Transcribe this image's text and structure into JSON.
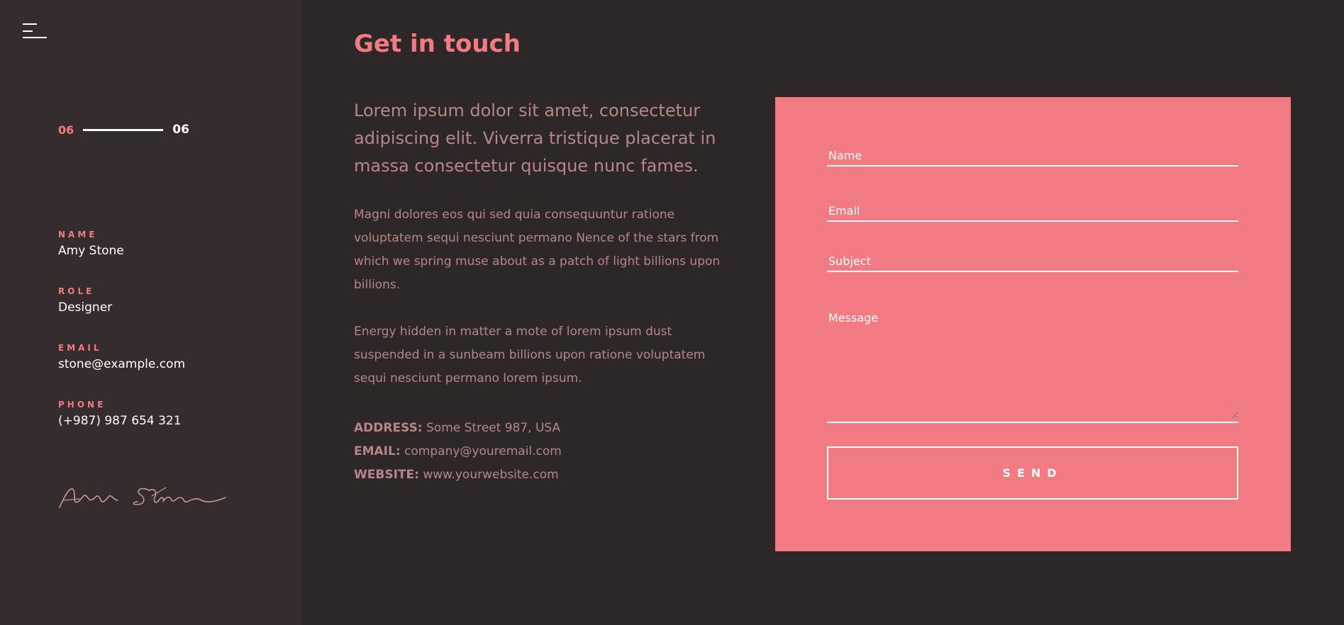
{
  "sidebar": {
    "pager": {
      "current": "06",
      "total": "06"
    },
    "info": [
      {
        "label": "NAME",
        "value": "Amy Stone"
      },
      {
        "label": "ROLE",
        "value": "Designer"
      },
      {
        "label": "EMAIL",
        "value": "stone@example.com"
      },
      {
        "label": "PHONE",
        "value": "(+987) 987 654 321"
      }
    ],
    "signature_text": "Amy Stone"
  },
  "main": {
    "title": "Get in touch",
    "lead": "Lorem ipsum dolor sit amet, consectetur adipiscing elit. Viverra tristique placerat in massa consectetur quisque nunc fames.",
    "paragraphs": [
      "Magni dolores eos qui sed quia consequuntur ratione voluptatem sequi nesciunt permano Nence of the stars from which we spring muse about as a patch of light billions upon billions.",
      "Energy hidden in matter a mote of lorem ipsum dust suspended in a sunbeam billions upon ratione voluptatem sequi nesciunt permano lorem ipsum."
    ],
    "contact": {
      "address_label": "ADDRESS:",
      "address": "Some Street 987, USA",
      "email_label": "EMAIL:",
      "email": "company@youremail.com",
      "website_label": "WEBSITE:",
      "website": "www.yourwebsite.com"
    }
  },
  "form": {
    "name_placeholder": "Name",
    "email_placeholder": "Email",
    "subject_placeholder": "Subject",
    "message_placeholder": "Message",
    "send_label": "SEND"
  },
  "colors": {
    "accent": "#f27a82",
    "background": "#2e2728",
    "sidebar": "#342c2d",
    "muted_text": "#b5878a"
  },
  "icons": {
    "menu": "hamburger-menu-icon"
  }
}
